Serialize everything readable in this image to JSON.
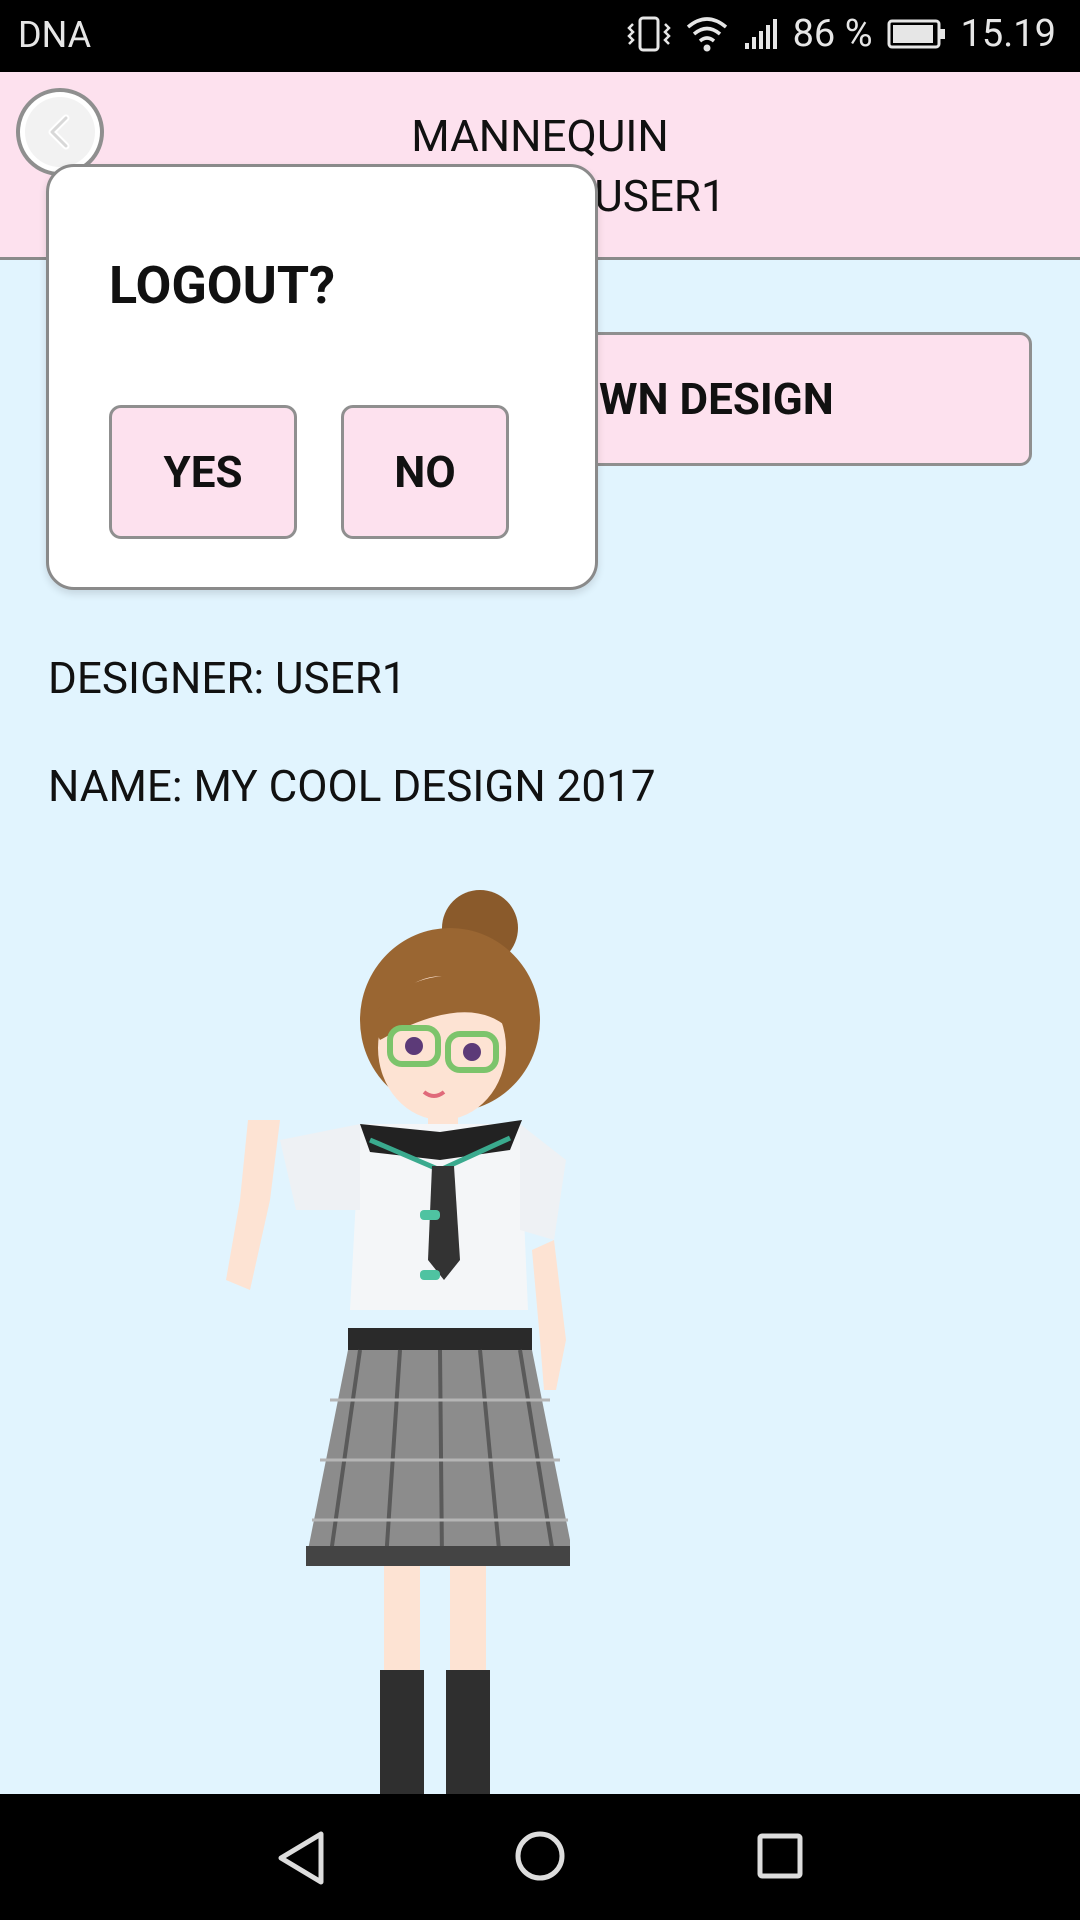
{
  "status_bar": {
    "carrier": "DNA",
    "battery_percent": "86 %",
    "time": "15.19",
    "icons": [
      "vibrate-icon",
      "wifi-icon",
      "signal-icon",
      "battery-icon"
    ]
  },
  "header": {
    "title_line1": "MANNEQUIN",
    "title_line2": "USER1",
    "back_icon": "chevron-left-icon"
  },
  "main": {
    "design_button_label": "WN DESIGN",
    "designer": "DESIGNER: USER1",
    "design_name": "NAME: MY COOL DESIGN 2017"
  },
  "dialog": {
    "title": "LOGOUT?",
    "yes_label": "YES",
    "no_label": "NO"
  },
  "colors": {
    "background": "#e1f4fe",
    "header_bg": "#fde1ee",
    "button_bg": "#fde1ee"
  },
  "nav_bar": {
    "icons": [
      "back-triangle-icon",
      "home-circle-icon",
      "recents-square-icon"
    ]
  }
}
